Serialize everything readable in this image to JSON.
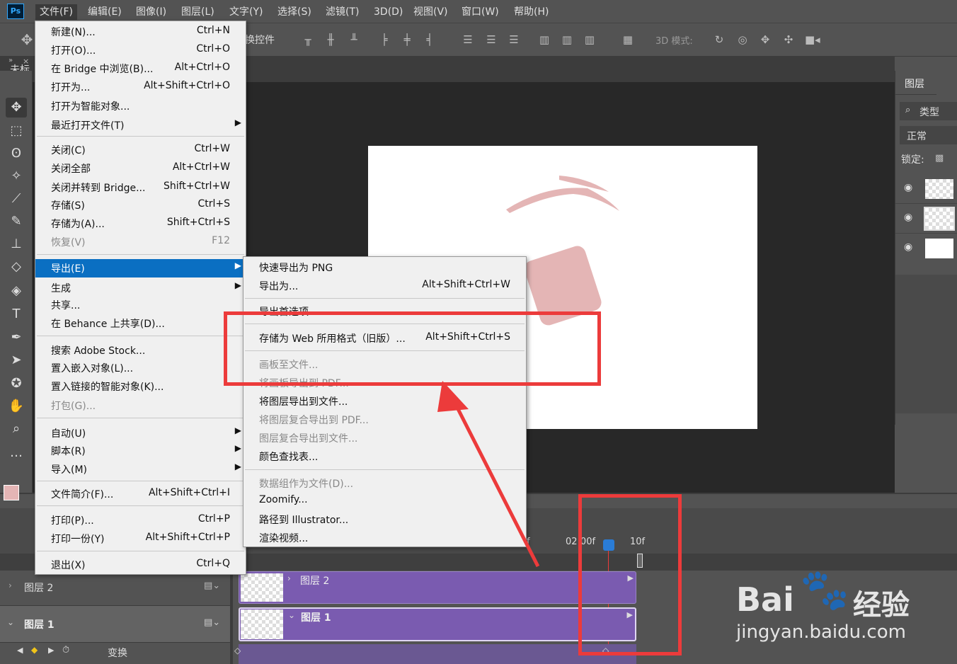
{
  "app": {
    "logo": "Ps"
  },
  "menubar": [
    "文件(F)",
    "编辑(E)",
    "图像(I)",
    "图层(L)",
    "文字(Y)",
    "选择(S)",
    "滤镜(T)",
    "3D(D)",
    "视图(V)",
    "窗口(W)",
    "帮助(H)"
  ],
  "optionsbar": {
    "transform_label": "换控件",
    "mode_3d": "3D 模式:"
  },
  "doc_tab": "未标",
  "file_menu": [
    {
      "label": "新建(N)...",
      "shortcut": "Ctrl+N"
    },
    {
      "label": "打开(O)...",
      "shortcut": "Ctrl+O"
    },
    {
      "label": "在 Bridge 中浏览(B)...",
      "shortcut": "Alt+Ctrl+O"
    },
    {
      "label": "打开为...",
      "shortcut": "Alt+Shift+Ctrl+O"
    },
    {
      "label": "打开为智能对象...",
      "shortcut": ""
    },
    {
      "label": "最近打开文件(T)",
      "shortcut": "",
      "submenu": true
    },
    {
      "label": "关闭(C)",
      "shortcut": "Ctrl+W"
    },
    {
      "label": "关闭全部",
      "shortcut": "Alt+Ctrl+W"
    },
    {
      "label": "关闭并转到 Bridge...",
      "shortcut": "Shift+Ctrl+W"
    },
    {
      "label": "存储(S)",
      "shortcut": "Ctrl+S"
    },
    {
      "label": "存储为(A)...",
      "shortcut": "Shift+Ctrl+S"
    },
    {
      "label": "恢复(V)",
      "shortcut": "F12",
      "disabled": true
    },
    {
      "label": "导出(E)",
      "shortcut": "",
      "submenu": true,
      "highlighted": true
    },
    {
      "label": "生成",
      "shortcut": "",
      "submenu": true
    },
    {
      "label": "共享...",
      "shortcut": ""
    },
    {
      "label": "在 Behance 上共享(D)...",
      "shortcut": ""
    },
    {
      "label": "搜索 Adobe Stock...",
      "shortcut": ""
    },
    {
      "label": "置入嵌入对象(L)...",
      "shortcut": ""
    },
    {
      "label": "置入链接的智能对象(K)...",
      "shortcut": ""
    },
    {
      "label": "打包(G)...",
      "shortcut": "",
      "disabled": true
    },
    {
      "label": "自动(U)",
      "shortcut": "",
      "submenu": true
    },
    {
      "label": "脚本(R)",
      "shortcut": "",
      "submenu": true
    },
    {
      "label": "导入(M)",
      "shortcut": "",
      "submenu": true
    },
    {
      "label": "文件简介(F)...",
      "shortcut": "Alt+Shift+Ctrl+I"
    },
    {
      "label": "打印(P)...",
      "shortcut": "Ctrl+P"
    },
    {
      "label": "打印一份(Y)",
      "shortcut": "Alt+Shift+Ctrl+P"
    },
    {
      "label": "退出(X)",
      "shortcut": "Ctrl+Q"
    }
  ],
  "export_menu": [
    {
      "label": "快速导出为 PNG",
      "shortcut": ""
    },
    {
      "label": "导出为...",
      "shortcut": "Alt+Shift+Ctrl+W"
    },
    {
      "label": "导出首选项...",
      "shortcut": ""
    },
    {
      "label": "存储为 Web 所用格式（旧版）...",
      "shortcut": "Alt+Shift+Ctrl+S"
    },
    {
      "label": "画板至文件...",
      "shortcut": "",
      "disabled": true
    },
    {
      "label": "将画板导出到 PDF...",
      "shortcut": "",
      "disabled": true
    },
    {
      "label": "将图层导出到文件...",
      "shortcut": ""
    },
    {
      "label": "将图层复合导出到 PDF...",
      "shortcut": "",
      "disabled": true
    },
    {
      "label": "图层复合导出到文件...",
      "shortcut": "",
      "disabled": true
    },
    {
      "label": "颜色查找表...",
      "shortcut": ""
    },
    {
      "label": "数据组作为文件(D)...",
      "shortcut": "",
      "disabled": true
    },
    {
      "label": "Zoomify...",
      "shortcut": ""
    },
    {
      "label": "路径到 Illustrator...",
      "shortcut": ""
    },
    {
      "label": "渲染视频...",
      "shortcut": ""
    }
  ],
  "layers_panel": {
    "tab": "图层",
    "filter": "类型",
    "blend": "正常",
    "lock": "锁定:"
  },
  "timeline": {
    "ruler": [
      "f",
      "02:00f",
      "10f"
    ],
    "layers": [
      {
        "name": "图层 2",
        "track": "图层 2"
      },
      {
        "name": "图层 1",
        "track": "图层 1"
      }
    ],
    "transform": "变换"
  },
  "watermark": {
    "brand": "Bai",
    "brand2": "经验",
    "url": "jingyan.baidu.com"
  },
  "colors": {
    "accent": "#0a6fc2",
    "annotation": "#ec3b3b",
    "track": "#7a5bb0",
    "shape": "#e4b5b5"
  }
}
